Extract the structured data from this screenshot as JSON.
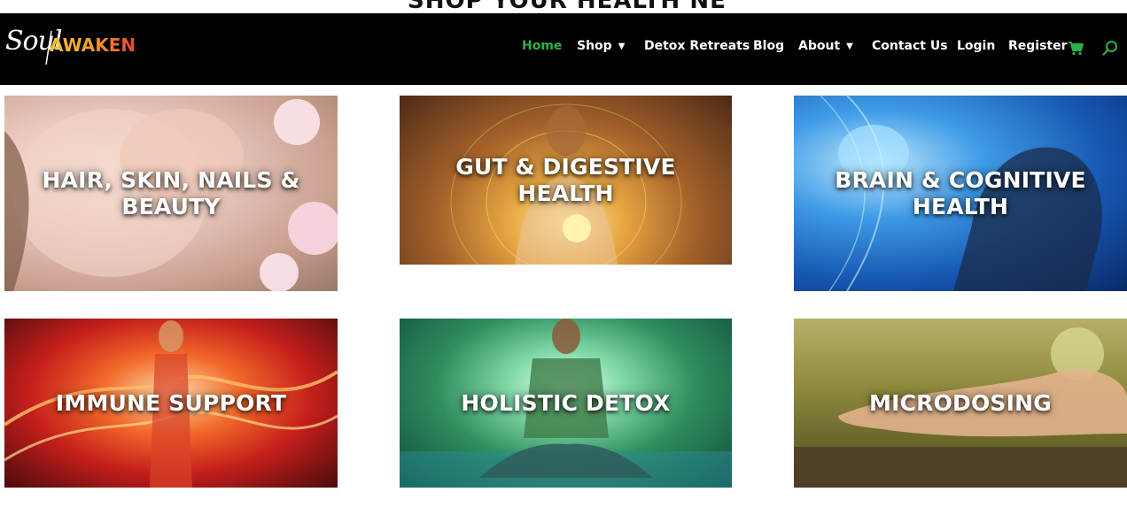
{
  "partial_heading": "SHOP YOUR HEALTH NEEDS",
  "header": {
    "logo": {
      "script": "Soul",
      "wordmark": "AWAKEN"
    },
    "nav": [
      {
        "label": "Home",
        "active": true,
        "has_dropdown": false
      },
      {
        "label": "Shop",
        "active": false,
        "has_dropdown": true
      },
      {
        "label": "Detox Retreats",
        "active": false,
        "has_dropdown": false
      },
      {
        "label": "Blog",
        "active": false,
        "has_dropdown": false
      },
      {
        "label": "About",
        "active": false,
        "has_dropdown": true
      },
      {
        "label": "Contact Us",
        "active": false,
        "has_dropdown": false
      },
      {
        "label": "Login",
        "active": false,
        "has_dropdown": false
      },
      {
        "label": "Register",
        "active": false,
        "has_dropdown": false
      }
    ],
    "icons": {
      "cart": "cart-icon",
      "search": "search-icon"
    },
    "accent_color": "#2bb24c"
  },
  "categories": [
    {
      "label": "HAIR, SKIN, NAILS & BEAUTY"
    },
    {
      "label": "GUT & DIGESTIVE HEALTH"
    },
    {
      "label": "BRAIN & COGNITIVE HEALTH"
    },
    {
      "label": "IMMUNE SUPPORT"
    },
    {
      "label": "HOLISTIC DETOX"
    },
    {
      "label": "MICRODOSING"
    }
  ]
}
